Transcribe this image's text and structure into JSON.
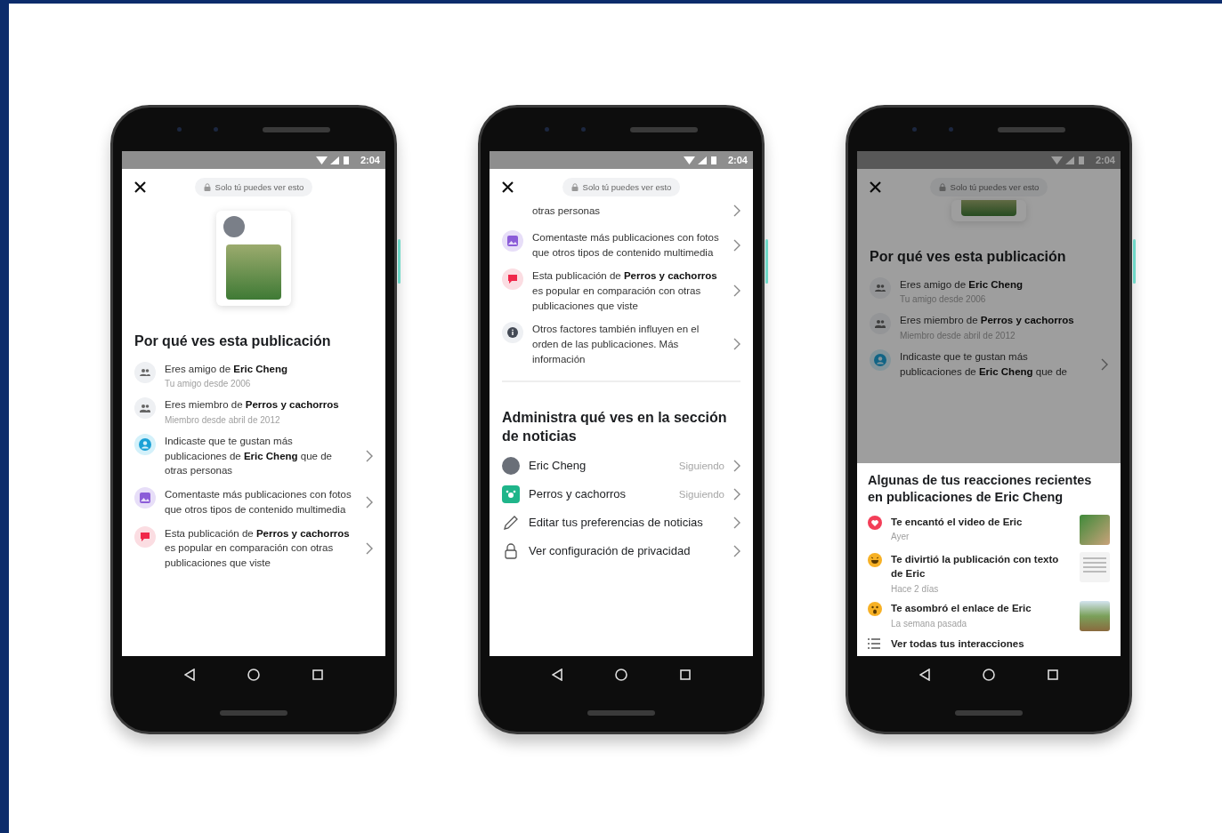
{
  "phones": [
    {
      "time": "2:04",
      "privacy_label": "Solo tú puedes ver esto",
      "dimmed": false,
      "preview": {
        "kind": "full"
      },
      "sections": [
        {
          "kind": "reasons",
          "heading": "Por qué ves esta publicación",
          "items": [
            {
              "kind": "friends",
              "text": "Eres amigo de **Eric Cheng**",
              "sub": "Tu amigo desde 2006",
              "chevron": false
            },
            {
              "kind": "group",
              "text": "Eres miembro de **Perros y cachorros**",
              "sub": "Miembro desde abril de 2012",
              "chevron": false
            },
            {
              "kind": "person",
              "text": "Indicaste que te gustan más publicaciones de **Eric Cheng** que de otras personas",
              "chevron": true
            },
            {
              "kind": "photo",
              "text": "Comentaste más publicaciones con fotos que otros tipos de contenido multimedia",
              "chevron": true
            },
            {
              "kind": "comment",
              "text": "Esta publicación de **Perros y cachorros** es popular en comparación con otras publicaciones que viste",
              "chevron": true
            }
          ]
        }
      ]
    },
    {
      "time": "2:04",
      "privacy_label": "Solo tú puedes ver esto",
      "dimmed": false,
      "sections": [
        {
          "kind": "reasons",
          "items": [
            {
              "kind": "none",
              "text": "otras personas",
              "chevron": true
            },
            {
              "kind": "photo",
              "text": "Comentaste más publicaciones con fotos que otros tipos de contenido multimedia",
              "chevron": true
            },
            {
              "kind": "comment",
              "text": "Esta publicación de **Perros y cachorros** es popular en comparación con otras publicaciones que viste",
              "chevron": true
            },
            {
              "kind": "info",
              "text": "Otros factores también influyen en el orden de las publicaciones. Más información",
              "chevron": true
            }
          ]
        },
        {
          "kind": "manage",
          "heading": "Administra qué ves en la sección de noticias",
          "items": [
            {
              "kind": "avatar",
              "label": "Eric Cheng",
              "status": "Siguiendo"
            },
            {
              "kind": "group",
              "label": "Perros y cachorros",
              "status": "Siguiendo"
            },
            {
              "kind": "pencil",
              "label": "Editar tus preferencias de noticias"
            },
            {
              "kind": "lock",
              "label": "Ver configuración de privacidad"
            }
          ]
        }
      ]
    },
    {
      "time": "2:04",
      "privacy_label": "Solo tú puedes ver esto",
      "dimmed": true,
      "preview": {
        "kind": "cropped"
      },
      "sections": [
        {
          "kind": "reasons",
          "heading": "Por qué ves esta publicación",
          "items": [
            {
              "kind": "friends",
              "text": "Eres amigo de **Eric Cheng**",
              "sub": "Tu amigo desde 2006",
              "chevron": false
            },
            {
              "kind": "group",
              "text": "Eres miembro de **Perros y cachorros**",
              "sub": "Miembro desde abril de 2012",
              "chevron": false
            },
            {
              "kind": "person",
              "text": "Indicaste que te gustan más publicaciones de **Eric Cheng** que de",
              "chevron": true
            }
          ]
        }
      ],
      "sheet": {
        "heading": "Algunas de tus reacciones recientes en publicaciones de Eric Cheng",
        "reactions": [
          {
            "kind": "love",
            "text": "Te encantó el video de Eric",
            "time": "Ayer",
            "thumbnail": {
              "kind": "video"
            }
          },
          {
            "kind": "haha",
            "text": "Te divirtió la publicación con texto de Eric",
            "time": "Hace 2 días",
            "thumbnail": {
              "kind": "text"
            }
          },
          {
            "kind": "wow",
            "text": "Te asombró el enlace de Eric",
            "time": "La semana pasada",
            "thumbnail": {
              "kind": "link"
            }
          }
        ],
        "footer_link": "Ver todas tus interacciones"
      }
    }
  ]
}
